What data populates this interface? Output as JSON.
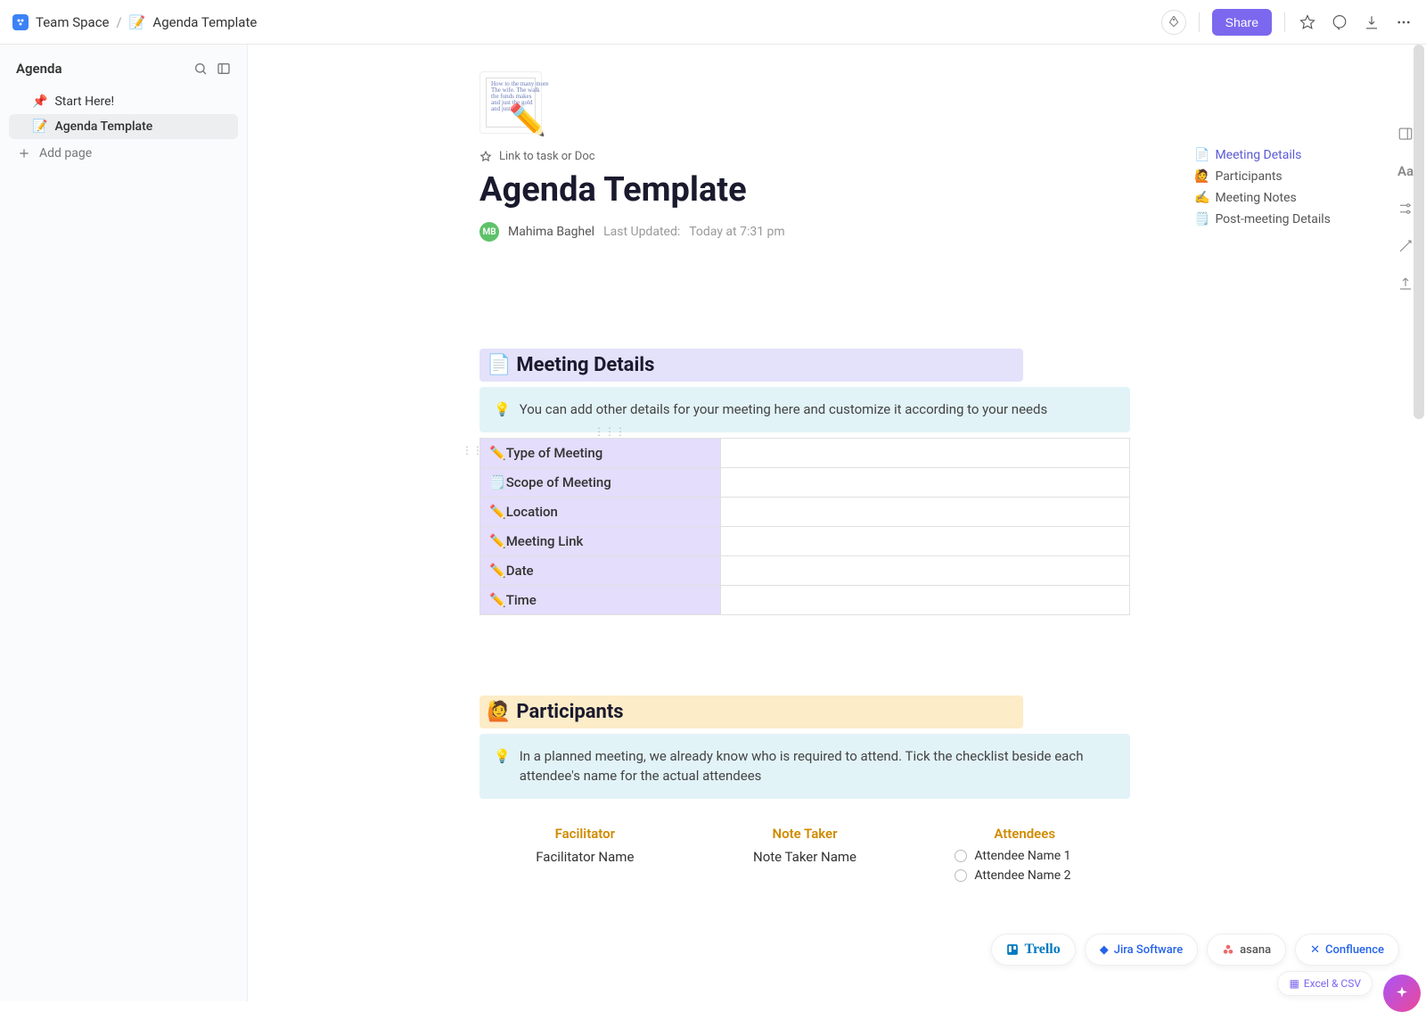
{
  "breadcrumb": {
    "space": "Team Space",
    "page": "Agenda Template"
  },
  "topbar": {
    "share": "Share"
  },
  "sidebar": {
    "title": "Agenda",
    "items": [
      {
        "icon": "📌",
        "label": "Start Here!"
      },
      {
        "icon": "📝",
        "label": "Agenda Template"
      }
    ],
    "add": "Add page"
  },
  "doc": {
    "link_task": "Link to task or Doc",
    "title": "Agenda Template",
    "author": "Mahima Baghel",
    "author_initials": "MB",
    "updated_label": "Last Updated:",
    "updated_value": "Today at 7:31 pm"
  },
  "toc": [
    {
      "icon": "📄",
      "label": "Meeting Details",
      "active": true
    },
    {
      "icon": "🙋",
      "label": "Participants"
    },
    {
      "icon": "✍️",
      "label": "Meeting Notes"
    },
    {
      "icon": "🗒️",
      "label": "Post-meeting Details"
    }
  ],
  "meeting_details": {
    "heading": "Meeting Details",
    "heading_icon": "📄",
    "callout": "You can add other details for your meeting here and customize it according to your needs",
    "rows": [
      {
        "icon": "✏️",
        "label": "Type of Meeting"
      },
      {
        "icon": "🗒️",
        "label": "Scope of Meeting"
      },
      {
        "icon": "✏️",
        "label": "Location"
      },
      {
        "icon": "✏️",
        "label": "Meeting Link"
      },
      {
        "icon": "✏️",
        "label": "Date"
      },
      {
        "icon": "✏️",
        "label": "Time"
      }
    ]
  },
  "participants": {
    "heading": "Participants",
    "heading_icon": "🙋",
    "callout": "In a planned meeting, we already know who is required to attend. Tick the checklist beside each attendee's name for the actual attendees",
    "cols": {
      "facilitator": {
        "title": "Facilitator",
        "value": "Facilitator Name"
      },
      "notetaker": {
        "title": "Note Taker",
        "value": "Note Taker Name"
      },
      "attendees": {
        "title": "Attendees",
        "values": [
          "Attendee Name 1",
          "Attendee Name 2"
        ]
      }
    }
  },
  "integrations": {
    "trello": "Trello",
    "jira": "Jira Software",
    "asana": "asana",
    "confluence": "Confluence",
    "excel": "Excel & CSV"
  }
}
